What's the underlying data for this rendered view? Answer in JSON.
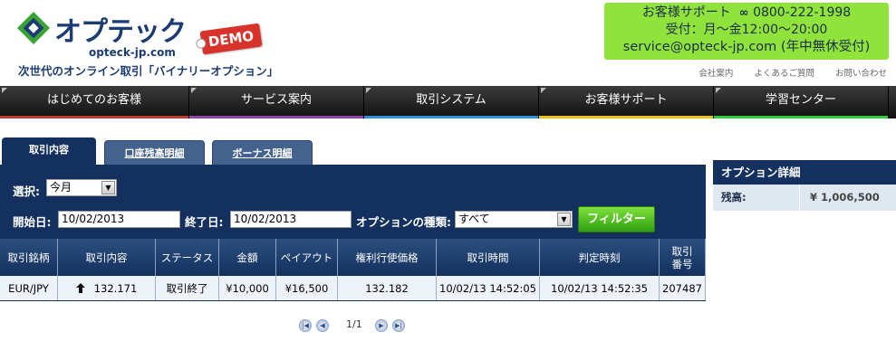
{
  "brand": {
    "name": "オプテック",
    "domain": "opteck-jp.com",
    "demo_label": "DEMO",
    "tagline": "次世代のオンライン取引「バイナリーオプション」"
  },
  "support": {
    "label": "お客様サポート",
    "phone": "0800-222-1998",
    "hours": "受付：月～金12:00～20:00",
    "email": "service@opteck-jp.com (年中無休受付)"
  },
  "header_links": [
    "会社案内",
    "よくあるご質問",
    "お問い合わせ"
  ],
  "nav": {
    "items": [
      {
        "label": "はじめてのお客様",
        "color": "#c0392b"
      },
      {
        "label": "サービス案内",
        "color": "#8e44ad"
      },
      {
        "label": "取引システム",
        "color": "#2f8fd8"
      },
      {
        "label": "お客様サポート",
        "color": "#e8c21c"
      },
      {
        "label": "学習センター",
        "color": "#2ecc40"
      }
    ]
  },
  "tabs": [
    {
      "label": "取引内容",
      "active": true
    },
    {
      "label": "口座残高明細",
      "active": false
    },
    {
      "label": "ボーナス明細",
      "active": false
    }
  ],
  "filters": {
    "select_label": "選択:",
    "select_value": "今月",
    "start_label": "開始日:",
    "start_value": "10/02/2013",
    "end_label": "終了日:",
    "end_value": "10/02/2013",
    "option_type_label": "オプションの種類:",
    "option_type_value": "すべて",
    "filter_button": "フィルター"
  },
  "table": {
    "headers": [
      "取引銘柄",
      "取引内容",
      "ステータス",
      "金額",
      "ペイアウト",
      "権利行使価格",
      "取引時間",
      "判定時刻",
      "取引番号"
    ],
    "rows": [
      {
        "symbol": "EUR/JPY",
        "direction_icon": "arrow-up-icon",
        "content": "132.171",
        "status": "取引終了",
        "amount": "¥10,000",
        "payout": "¥16,500",
        "strike": "132.182",
        "trade_time": "10/02/13 14:52:05",
        "judge_time": "10/02/13 14:52:35",
        "trade_no": "207487"
      }
    ]
  },
  "pager": {
    "text": "1/1"
  },
  "side": {
    "title": "オプション詳細",
    "balance_label": "残高:",
    "balance_value": "¥ 1,006,500"
  }
}
